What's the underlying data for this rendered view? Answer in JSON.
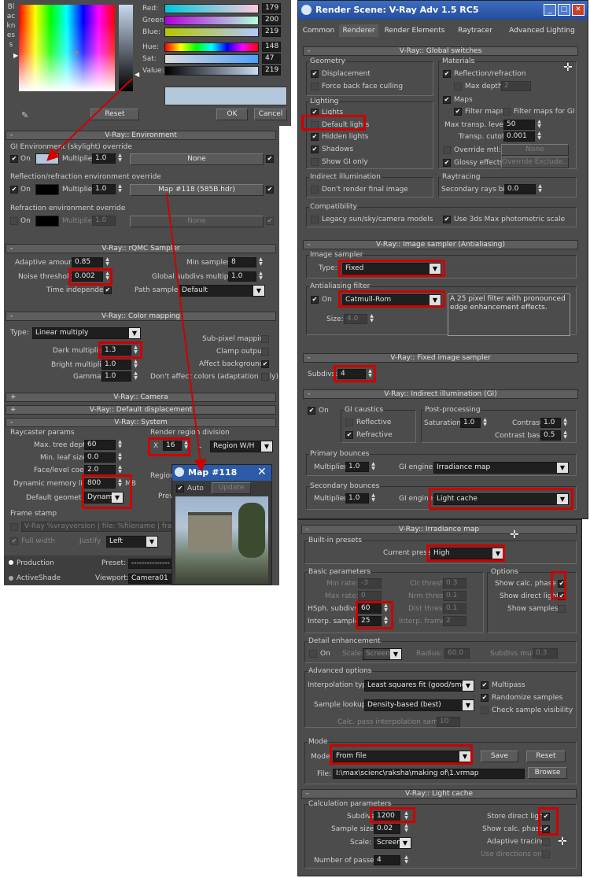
{
  "color_picker": {
    "side_label": "Blackness",
    "channels": [
      {
        "label": "Red:",
        "value": "179"
      },
      {
        "label": "Green:",
        "value": "200"
      },
      {
        "label": "Blue:",
        "value": "219"
      },
      {
        "label": "Hue:",
        "value": "148"
      },
      {
        "label": "Sat:",
        "value": "47"
      },
      {
        "label": "Value:",
        "value": "219"
      }
    ],
    "reset": "Reset",
    "ok": "OK",
    "cancel": "Cancel",
    "swatch_color": "#b3c8db"
  },
  "env": {
    "header": "V-Ray:: Environment",
    "gi_title": "GI Environment (skylight) override",
    "on": "On",
    "multiplier": "Multiplier:",
    "gi_mult": "1.0",
    "none": "None",
    "refl_title": "Reflection/refraction environment override",
    "refl_mult": "1.0",
    "refl_map": "Map #118 (585B.hdr)",
    "refr_title": "Refraction environment override",
    "refr_mult": "1.0"
  },
  "qmc": {
    "header": "V-Ray:: rQMC Sampler",
    "adaptive_label": "Adaptive amount:",
    "adaptive": "0.85",
    "noise_label": "Noise threshold:",
    "noise": "0.002",
    "time_label": "Time independent",
    "min_label": "Min samples:",
    "min": "8",
    "gsm_label": "Global subdivs multiplier:",
    "gsm": "1.0",
    "path_label": "Path sampler:",
    "path": "Default"
  },
  "cmap": {
    "header": "V-Ray:: Color mapping",
    "type_label": "Type:",
    "type": "Linear multiply",
    "dark_label": "Dark multiplier:",
    "dark": "1.3",
    "bright_label": "Bright multiplier:",
    "bright": "1.0",
    "gamma_label": "Gamma:",
    "gamma": "1.0",
    "subpixel": "Sub-pixel mapping",
    "clamp": "Clamp output",
    "affect_bg": "Affect background",
    "dont_affect": "Don't affect colors (adaptation only)"
  },
  "camera": {
    "header": "V-Ray:: Camera"
  },
  "disp": {
    "header": "V-Ray:: Default displacement"
  },
  "system": {
    "header": "V-Ray:: System",
    "raycaster": "Raycaster params",
    "tree_label": "Max. tree depth:",
    "tree": "60",
    "leaf_label": "Min. leaf size:",
    "leaf": "0.0",
    "face_label": "Face/level coef.",
    "face": "2.0",
    "mem_label": "Dynamic memory limit",
    "mem": "800",
    "mem_unit": "MB",
    "geom_label": "Default geometry",
    "geom": "Dynamic",
    "region_title": "Render region division",
    "x": "X",
    "region_val": "16",
    "l": "L",
    "region_mode": "Region W/H",
    "region": "Region",
    "prev": "Prev",
    "stamp": "Frame stamp",
    "stamp_text": "V-Ray %vrayversion | file: %filename | frame: %f",
    "full_width": "Full width",
    "justify": "Justify",
    "justify_val": "Left"
  },
  "bottom": {
    "production": "Production",
    "preset": "Preset:",
    "preset_val": "---------------",
    "activeshade": "ActiveShade",
    "viewport": "Viewport:",
    "viewport_val": "Camera01"
  },
  "mapwin": {
    "title": "Map #118",
    "auto": "Auto",
    "update": "Update"
  },
  "rs": {
    "title": "Render Scene: V-Ray Adv 1.5 RC5",
    "tabs": [
      "Common",
      "Renderer",
      "Render Elements",
      "Raytracer",
      "Advanced Lighting"
    ]
  },
  "gs": {
    "header": "V-Ray:: Global switches",
    "geometry": "Geometry",
    "displacement": "Displacement",
    "force_back": "Force back face culling",
    "lighting": "Lighting",
    "lights": "Lights",
    "default_lights": "Default lights",
    "hidden_lights": "Hidden lights",
    "shadows": "Shadows",
    "show_gi": "Show GI only",
    "materials": "Materials",
    "refl_refr": "Reflection/refraction",
    "max_depth": "Max depth",
    "max_depth_val": "2",
    "maps": "Maps",
    "filter_maps": "Filter maps",
    "filter_gi": "Filter maps for GI",
    "transp_label": "Max transp. levels",
    "transp": "50",
    "cutoff_label": "Transp. cutoff",
    "cutoff": "0.001",
    "override_mtl": "Override mtl:",
    "none": "None",
    "glossy": "Glossy effects",
    "override_exclude": "Override Exclude...",
    "indirect": "Indirect illumination",
    "dont_render": "Don't render final image",
    "raytracing": "Raytracing",
    "secondary_bias": "Secondary rays bias",
    "bias": "0.0",
    "compat": "Compatibility",
    "legacy": "Legacy sun/sky/camera models",
    "photometric": "Use 3ds Max photometric scale"
  },
  "is": {
    "header": "V-Ray:: Image sampler (Antialiasing)",
    "sampler": "Image sampler",
    "type_label": "Type:",
    "type": "Fixed",
    "aa": "Antialiasing filter",
    "on": "On",
    "filter": "Catmull-Rom",
    "desc": "A 25 pixel filter with pronounced edge enhancement effects.",
    "size_label": "Size:",
    "size": "4.0"
  },
  "fixed": {
    "header": "V-Ray:: Fixed image sampler",
    "subdivs_label": "Subdivs:",
    "subdivs": "4"
  },
  "gi": {
    "header": "V-Ray:: Indirect illumination (GI)",
    "on": "On",
    "caustics": "GI caustics",
    "reflective": "Reflective",
    "refractive": "Refractive",
    "post": "Post-processing",
    "sat_label": "Saturation:",
    "sat": "1.0",
    "contrast_label": "Contrast:",
    "contrast": "1.0",
    "cbase_label": "Contrast base:",
    "cbase": "0.5",
    "primary": "Primary bounces",
    "mult_label": "Multiplier:",
    "p_mult": "1.0",
    "engine_label": "GI engine:",
    "p_engine": "Irradiance map",
    "secondary": "Secondary bounces",
    "s_mult": "1.0",
    "s_engine": "Light cache"
  },
  "im": {
    "header": "V-Ray:: Irradiance map",
    "builtin": "Built-in presets",
    "current_label": "Current preset:",
    "current": "High",
    "basic": "Basic parameters",
    "min_rate_label": "Min rate:",
    "min_rate": "-3",
    "max_rate_label": "Max rate:",
    "max_rate": "0",
    "hsph_label": "HSph. subdivs:",
    "hsph": "60",
    "interp_label": "Interp. samples:",
    "interp": "25",
    "clr_label": "Clr thresh:",
    "clr": "0.3",
    "nrm_label": "Nrm thresh:",
    "nrm": "0.1",
    "dist_label": "Dist thresh:",
    "dist": "0.1",
    "frames_label": "Interp. frames:",
    "frames": "2",
    "options": "Options",
    "show_calc": "Show calc. phase",
    "show_direct": "Show direct light",
    "show_samples": "Show samples",
    "detail": "Detail enhancement",
    "on": "On",
    "scale_label": "Scale:",
    "scale": "Screen",
    "radius_label": "Radius:",
    "radius": "60.0",
    "subdivs_mult_label": "Subdivs mult.",
    "subdivs_mult": "0.3",
    "advanced": "Advanced options",
    "interp_type_label": "Interpolation type:",
    "interp_type": "Least squares fit (good/smooth)",
    "multipass": "Multipass",
    "lookup_label": "Sample lookup:",
    "lookup": "Density-based (best)",
    "randomize": "Randomize samples",
    "check_vis": "Check sample visibility",
    "calc_pass_label": "Calc. pass interpolation samples:",
    "calc_pass": "10",
    "mode": "Mode",
    "mode_label": "Mode:",
    "mode_val": "From file",
    "save": "Save",
    "reset": "Reset",
    "file_label": "File:",
    "file": "I:\\max\\scienc\\raksha\\making of\\1.vrmap",
    "browse": "Browse"
  },
  "lc": {
    "header": "V-Ray:: Light cache",
    "calc": "Calculation parameters",
    "subdivs_label": "Subdivs:",
    "subdivs": "1200",
    "size_label": "Sample size:",
    "size": "0.02",
    "scale_label": "Scale:",
    "scale": "Screen",
    "passes_label": "Number of passes:",
    "passes": "4",
    "store_direct": "Store direct light",
    "show_calc": "Show calc. phase",
    "adaptive": "Adaptive tracing",
    "directions": "Use directions only"
  }
}
